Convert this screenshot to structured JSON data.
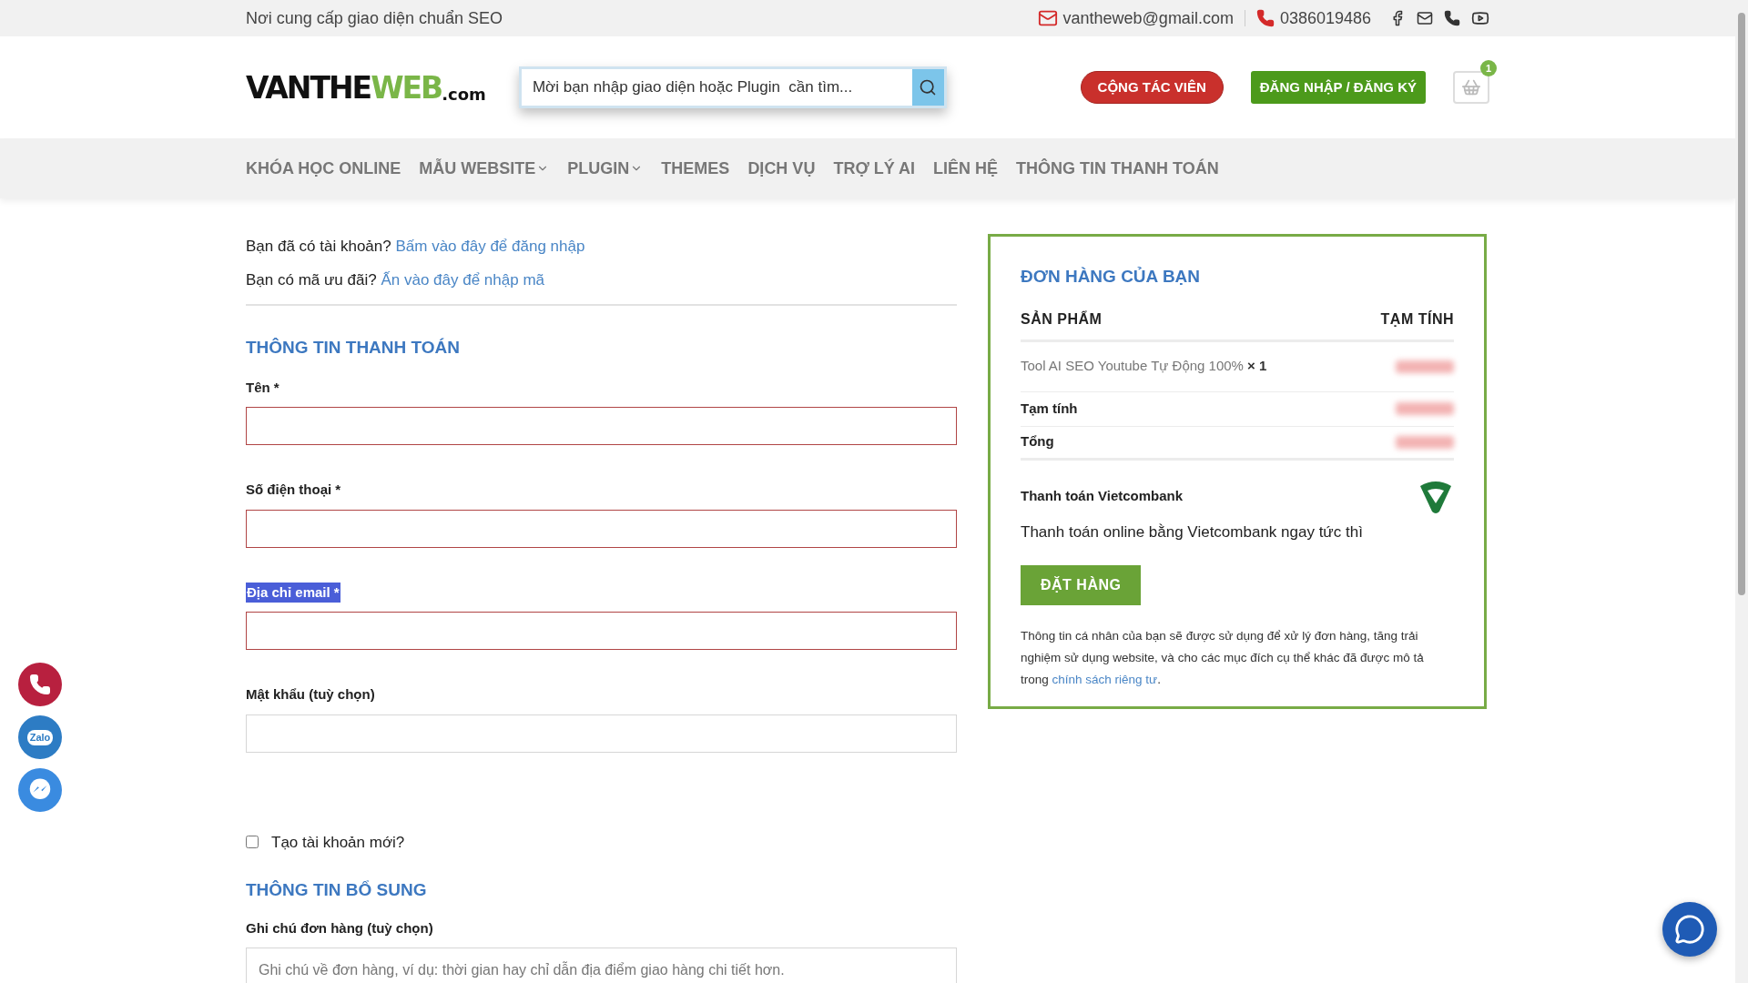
{
  "top_bar": {
    "tagline": "Nơi cung cấp giao diện chuẩn SEO",
    "email": "vantheweb@gmail.com",
    "phone": "0386019486"
  },
  "header": {
    "logo": {
      "dark": "VANTHE",
      "accent": "WEB",
      "suffix": ".com"
    },
    "search": {
      "placeholder": "Mời bạn nhập giao diện hoặc Plugin  cần tìm..."
    },
    "buttons": [
      {
        "kind": "pill",
        "label": "CỘNG TÁC VIÊN"
      },
      {
        "kind": "box",
        "label": "ĐĂNG NHẬP / ĐĂNG KÝ"
      }
    ],
    "cart_count": "1"
  },
  "nav": [
    {
      "label": "KHÓA HỌC ONLINE",
      "has_dropdown": false
    },
    {
      "label": "MẪU WEBSITE",
      "has_dropdown": true
    },
    {
      "label": "PLUGIN",
      "has_dropdown": true
    },
    {
      "label": "THEMES",
      "has_dropdown": false
    },
    {
      "label": "DỊCH VỤ",
      "has_dropdown": false
    },
    {
      "label": "TRỢ LÝ AI",
      "has_dropdown": false
    },
    {
      "label": "LIÊN HỆ",
      "has_dropdown": false
    },
    {
      "label": "THÔNG TIN THANH TOÁN",
      "has_dropdown": false
    }
  ],
  "notices": [
    {
      "text": "Bạn đã có tài khoản?",
      "link": "Bấm vào đây để đăng nhập"
    },
    {
      "text": "Bạn có mã ưu đãi?",
      "link": "Ấn vào đây để nhập mã"
    }
  ],
  "billing": {
    "title": "THÔNG TIN THANH TOÁN",
    "fields": [
      {
        "label": "Tên *",
        "required": true,
        "highlighted": false
      },
      {
        "label": "Số điện thoại *",
        "required": true,
        "highlighted": false
      },
      {
        "label": "Địa chỉ email *",
        "required": true,
        "highlighted": true
      },
      {
        "label": "Mật khẩu (tuỳ chọn)",
        "required": false,
        "highlighted": false
      }
    ],
    "create_account": {
      "label": "Tạo tài khoản mới?",
      "checked": false
    }
  },
  "additional": {
    "title": "THÔNG TIN BỔ SUNG",
    "note_label": "Ghi chú đơn hàng (tuỳ chọn)",
    "placeholder": "Ghi chú về đơn hàng, ví dụ: thời gian hay chỉ dẫn địa điểm giao hàng chi tiết hơn."
  },
  "floating": {
    "chat_label": "Zalo"
  },
  "order": {
    "title": "ĐƠN HÀNG CỦA BẠN",
    "columns": [
      "SẢN PHẨM",
      "TẠM TÍNH"
    ],
    "item": {
      "name": "Tool AI SEO Youtube Tự Động 100%",
      "quantity": "× 1"
    },
    "totals": [
      "Tạm tính",
      "Tổng"
    ],
    "payment": {
      "name": "Thanh toán Vietcombank",
      "description": "Thanh toán online bằng Vietcombank ngay tức thì"
    },
    "submit": "ĐẶT HÀNG",
    "privacy": {
      "text": "Thông tin cá nhân của bạn sẽ được sử dụng để xử lý đơn hàng, tăng trải nghiệm sử dụng website, và cho các mục đích cụ thể khác đã được mô tả trong",
      "link": "chính sách riêng tư",
      "end": "."
    }
  }
}
